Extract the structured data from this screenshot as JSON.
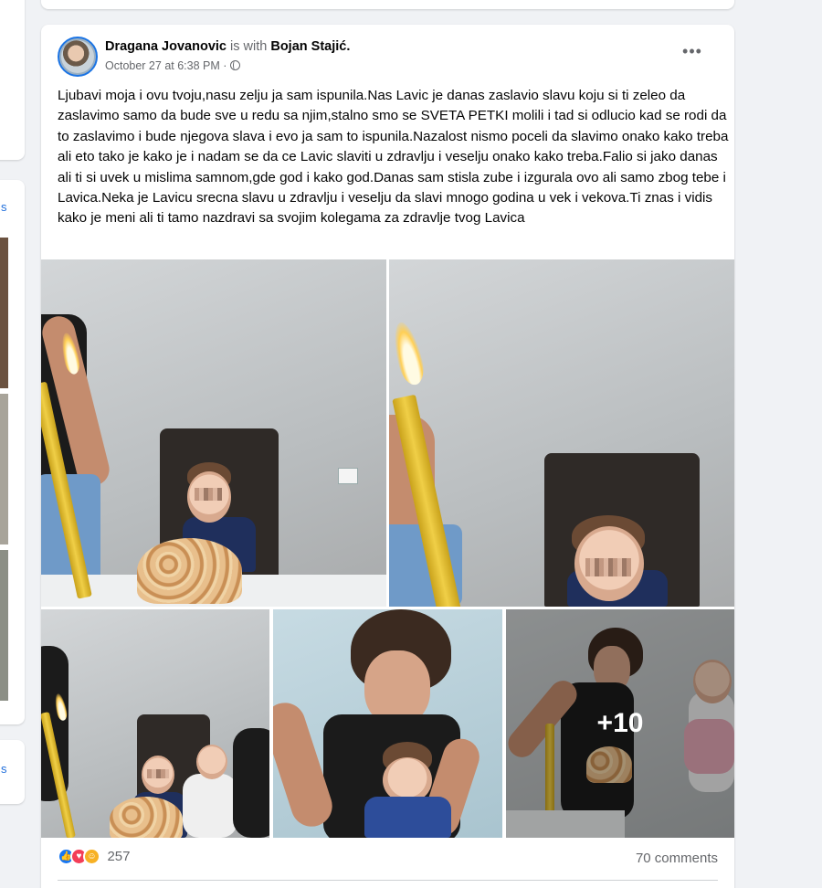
{
  "sidebar": {
    "link_1": "s",
    "link_2": "s"
  },
  "post": {
    "author": "Dragana Jovanovic",
    "with_text": "is with",
    "tagged": "Bojan Stajić.",
    "timestamp": "October 27 at 6:38 PM",
    "separator": "·",
    "privacy_icon": "globe-icon",
    "more_icon": "•••",
    "text": "Ljubavi moja i ovu tvoju,nasu zelju ja sam ispunila.Nas Lavic je danas zaslavio slavu koju si ti zeleo da zaslavimo samo da bude sve u redu sa njim,stalno smo se  SVETA PETKI molili  i tad si odlucio kad se rodi da to zaslavimo i bude njegova slava i evo ja sam to ispunila.Nazalost nismo poceli da slavimo onako kako treba ali eto tako je kako je i nadam se da ce Lavic slaviti u zdravlju i veselju onako kako treba.Falio si jako danas ali ti si uvek u mislima samnom,gde god i kako god.Danas sam stisla zube i izgurala ovo ali samo zbog tebe i Lavica.Neka je Lavicu srecna slavu u zdravlju i veselju da slavi mnogo godina u vek i vekova.Ti znas i vidis kako je meni ali ti tamo nazdravi  sa svojim kolegama za zdravlje tvog Lavica",
    "photos_more": "+10",
    "reactions": {
      "icons": [
        "like-icon",
        "love-icon",
        "care-icon"
      ],
      "count": "257"
    },
    "comments": "70 comments"
  },
  "colors": {
    "accent": "#1877f2",
    "link": "#216fdb",
    "muted": "#65676b",
    "background": "#f0f2f5"
  }
}
